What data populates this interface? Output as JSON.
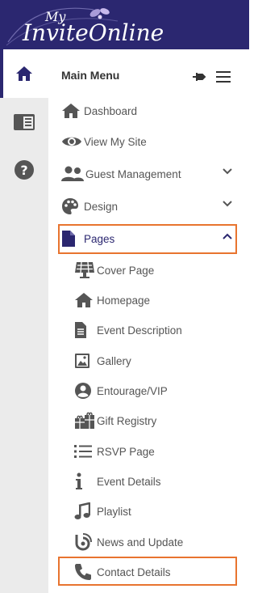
{
  "brand": {
    "logo_text_top": "My",
    "logo_text_main": "InviteOnline"
  },
  "rail": {
    "items": [
      {
        "name": "home-icon",
        "active": true
      },
      {
        "name": "dashboard-panel-icon",
        "active": false
      },
      {
        "name": "help-icon",
        "active": false
      }
    ]
  },
  "menu": {
    "title": "Main Menu",
    "items": [
      {
        "label": "Dashboard",
        "icon": "home-icon"
      },
      {
        "label": "View My Site",
        "icon": "eye-icon"
      },
      {
        "label": "Guest Management",
        "icon": "users-icon",
        "expandable": true,
        "expanded": false
      },
      {
        "label": "Design",
        "icon": "palette-icon",
        "expandable": true,
        "expanded": false
      },
      {
        "label": "Pages",
        "icon": "file-icon",
        "expandable": true,
        "expanded": true,
        "highlighted": true
      }
    ],
    "pages_sub": [
      {
        "label": "Cover Page",
        "icon": "solar-panel-icon"
      },
      {
        "label": "Homepage",
        "icon": "home-icon"
      },
      {
        "label": "Event Description",
        "icon": "document-icon"
      },
      {
        "label": "Gallery",
        "icon": "image-icon"
      },
      {
        "label": "Entourage/VIP",
        "icon": "person-circle-icon"
      },
      {
        "label": "Gift Registry",
        "icon": "gifts-icon"
      },
      {
        "label": "RSVP Page",
        "icon": "list-icon"
      },
      {
        "label": "Event Details",
        "icon": "info-icon"
      },
      {
        "label": "Playlist",
        "icon": "music-note-icon"
      },
      {
        "label": "News and Update",
        "icon": "blog-icon"
      },
      {
        "label": "Contact Details",
        "icon": "phone-icon",
        "highlighted": true
      }
    ]
  },
  "colors": {
    "brand": "#2b2770",
    "highlight": "#e8742f",
    "text": "#555555",
    "rail_bg": "#ebebeb"
  }
}
